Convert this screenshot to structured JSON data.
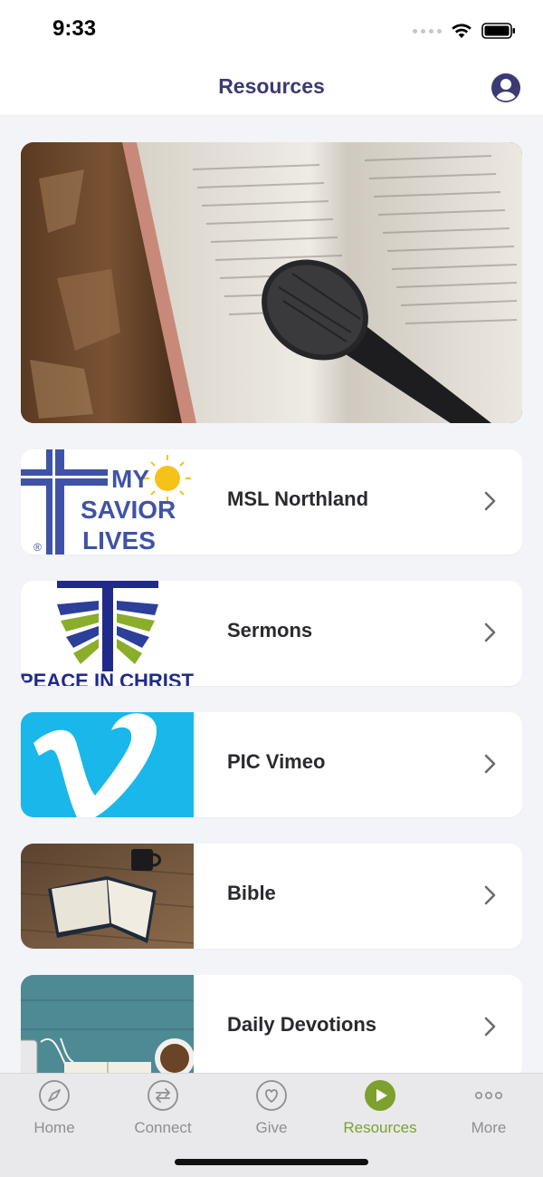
{
  "status_bar": {
    "time": "9:33"
  },
  "header": {
    "title": "Resources"
  },
  "icons": {
    "profile": "user-circle-icon",
    "chevron": "chevron-right-icon"
  },
  "resources": [
    {
      "label": "MSL Northland",
      "thumb_text": [
        "MY",
        "SAVIOR",
        "LIVES"
      ],
      "thumb_mark": "®"
    },
    {
      "label": "Sermons",
      "thumb_text": "PEACE IN CHRIST"
    },
    {
      "label": "PIC Vimeo"
    },
    {
      "label": "Bible"
    },
    {
      "label": "Daily Devotions"
    }
  ],
  "tabs": [
    {
      "label": "Home",
      "icon": "compass-icon",
      "active": false
    },
    {
      "label": "Connect",
      "icon": "exchange-icon",
      "active": false
    },
    {
      "label": "Give",
      "icon": "heart-icon",
      "active": false
    },
    {
      "label": "Resources",
      "icon": "play-icon",
      "active": true
    },
    {
      "label": "More",
      "icon": "more-dots-icon",
      "active": false
    }
  ],
  "colors": {
    "title": "#3b3a74",
    "accent_active": "#7da02e",
    "tab_inactive": "#8e8e93",
    "background": "#f3f4f8"
  }
}
